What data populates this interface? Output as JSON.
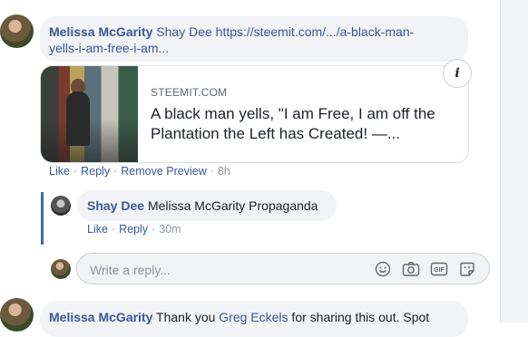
{
  "comment1": {
    "author": "Melissa McGarity",
    "mention": "Shay Dee",
    "link_line1": "https://steemit.com/.../a-black-man-",
    "link_line2": "yells-i-am-free-i-am...",
    "actions": [
      "Like",
      "Reply",
      "Remove Preview"
    ],
    "time": "8h"
  },
  "preview": {
    "domain": "STEEMIT.COM",
    "title_line1": "A black man yells, \"I am Free, I am off the",
    "title_line2": "Plantation the Left has Created! —...",
    "info_icon": "info-icon",
    "info_glyph": "i"
  },
  "reply1": {
    "author": "Shay Dee",
    "text": "Melissa McGarity Propaganda",
    "actions": [
      "Like",
      "Reply"
    ],
    "time": "30m"
  },
  "reply_box": {
    "placeholder": "Write a reply...",
    "icons": [
      "emoji-icon",
      "camera-icon",
      "gif-icon",
      "sticker-icon"
    ],
    "icon_labels": {
      "gif": "GIF"
    }
  },
  "comment2": {
    "author": "Melissa McGarity",
    "text_before": "Thank you ",
    "mention": "Greg Eckels",
    "text_after": " for sharing this out. Spot"
  },
  "colors": {
    "link": "#385898",
    "bubble": "#f2f3f5",
    "thread_rule": "#4267b2",
    "meta": "#90949c"
  }
}
